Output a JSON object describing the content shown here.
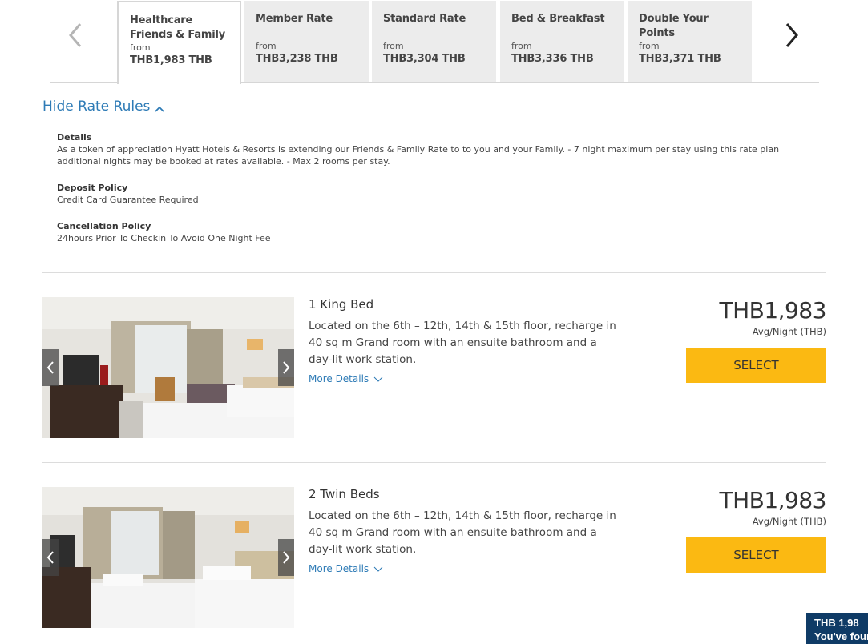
{
  "rate_tabs": {
    "prev_icon": "chevron-left-icon",
    "next_icon": "chevron-right-icon",
    "items": [
      {
        "name": "Healthcare Friends & Family",
        "from_label": "from",
        "price": "THB1,983 THB",
        "active": true
      },
      {
        "name": "Member Rate",
        "from_label": "from",
        "price": "THB3,238 THB",
        "active": false
      },
      {
        "name": "Standard Rate",
        "from_label": "from",
        "price": "THB3,304 THB",
        "active": false
      },
      {
        "name": "Bed & Breakfast",
        "from_label": "from",
        "price": "THB3,336 THB",
        "active": false
      },
      {
        "name": "Double Your Points",
        "from_label": "from",
        "price": "THB3,371 THB",
        "active": false
      }
    ]
  },
  "rate_rules": {
    "toggle_label": "Hide Rate Rules",
    "toggle_icon": "chevron-up-icon",
    "sections": [
      {
        "title": "Details",
        "text": "As a token of appreciation Hyatt Hotels & Resorts is extending our Friends & Family Rate to to you and your Family. - 7 night maximum per stay using this rate plan additional nights may be booked at rates available. - Max 2 rooms per stay."
      },
      {
        "title": "Deposit Policy",
        "text": "Credit Card Guarantee Required"
      },
      {
        "title": "Cancellation Policy",
        "text": "24hours Prior To Checkin To Avoid One Night Fee"
      }
    ]
  },
  "rooms": [
    {
      "name": "1 King Bed",
      "description": "Located on the 6th – 12th, 14th & 15th floor, recharge in 40 sq m Grand room with an ensuite bathroom and a day-lit work station.",
      "more_details_label": "More Details",
      "price": "THB1,983",
      "price_note": "Avg/Night (THB)",
      "select_label": "SELECT"
    },
    {
      "name": "2 Twin Beds",
      "description": "Located on the 6th – 12th, 14th & 15th floor, recharge in 40 sq m Grand room with an ensuite bathroom and a day-lit work station.",
      "more_details_label": "More Details",
      "price": "THB1,983",
      "price_note": "Avg/Night (THB)",
      "select_label": "SELECT"
    }
  ],
  "promo": {
    "line1": "THB 1,98",
    "line2": "You've four"
  },
  "colors": {
    "accent_link": "#2e7bb6",
    "select_button": "#fbb912",
    "tab_inactive": "#ececec",
    "promo_bg": "#0f3b66"
  }
}
